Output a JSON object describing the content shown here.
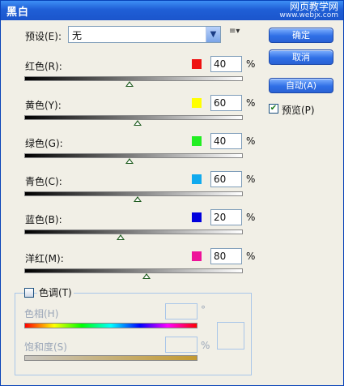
{
  "window": {
    "title": "黑白",
    "watermark_line1": "网页教学网",
    "watermark_line2": "www.webjx.com"
  },
  "preset": {
    "label": "预设(E):",
    "value": "无"
  },
  "buttons": {
    "ok": "确定",
    "cancel": "取消",
    "auto": "自动(A)"
  },
  "preview": {
    "label": "预览(P)",
    "checked": true
  },
  "sliders": [
    {
      "label": "红色(R):",
      "value": "40",
      "unit": "%",
      "swatch_color": "#ee1111",
      "level": 40
    },
    {
      "label": "黄色(Y):",
      "value": "60",
      "unit": "%",
      "swatch_color": "#ffff00",
      "level": 60
    },
    {
      "label": "绿色(G):",
      "value": "40",
      "unit": "%",
      "swatch_color": "#22ee22",
      "level": 40
    },
    {
      "label": "青色(C):",
      "value": "60",
      "unit": "%",
      "swatch_color": "#11aaee",
      "level": 60
    },
    {
      "label": "蓝色(B):",
      "value": "20",
      "unit": "%",
      "swatch_color": "#0000dd",
      "level": 20
    },
    {
      "label": "洋红(M):",
      "value": "80",
      "unit": "%",
      "swatch_color": "#ee1199",
      "level": 80
    }
  ],
  "tint": {
    "legend": "色调(T)",
    "enabled": false,
    "hue_label": "色相(H)",
    "hue_unit": "°",
    "saturation_label": "饱和度(S)",
    "saturation_unit": "%"
  }
}
